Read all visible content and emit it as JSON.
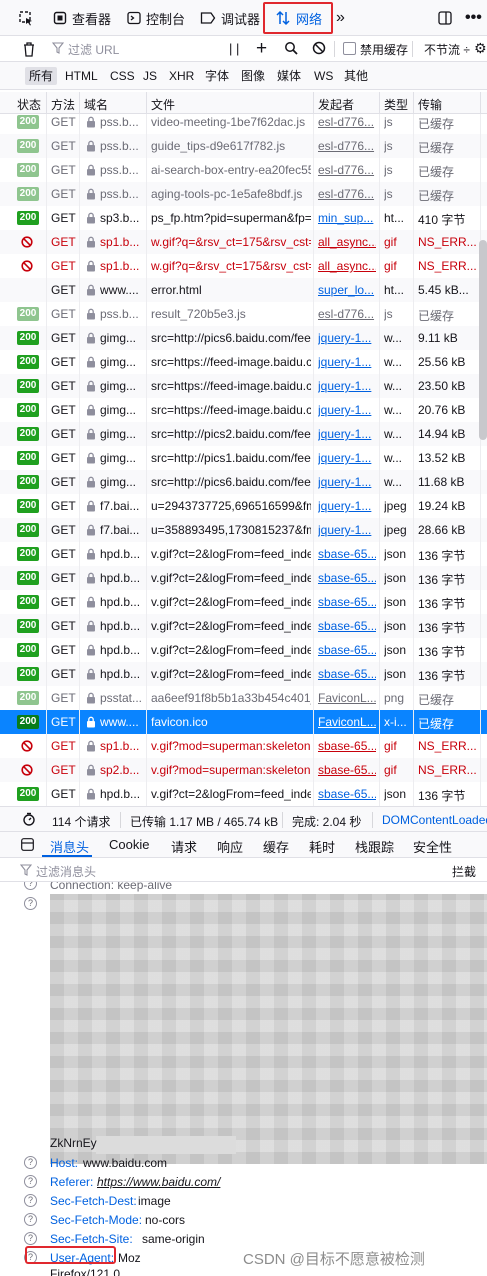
{
  "toolbar": {
    "tabs": [
      {
        "label": "查看器"
      },
      {
        "label": "控制台"
      },
      {
        "label": "调试器"
      },
      {
        "label": "网络"
      }
    ]
  },
  "filter": {
    "placeholder": "过滤 URL",
    "disable_cache": "禁用缓存",
    "throttle": "不节流 ÷"
  },
  "type_filters": [
    "所有",
    "HTML",
    "CSS",
    "JS",
    "XHR",
    "字体",
    "图像",
    "媒体",
    "WS",
    "其他"
  ],
  "columns": [
    "状态",
    "方法",
    "域名",
    "文件",
    "发起者",
    "类型",
    "传输"
  ],
  "requests": [
    {
      "status": "200",
      "state": "cached",
      "method": "GET",
      "domain": "pss.b...",
      "file": "video-meeting-1be7f62dac.js",
      "initiator": "esl-d776...",
      "type": "js",
      "transfer": "已缓存"
    },
    {
      "status": "200",
      "state": "cached",
      "method": "GET",
      "domain": "pss.b...",
      "file": "guide_tips-d9e617f782.js",
      "initiator": "esl-d776...",
      "type": "js",
      "transfer": "已缓存"
    },
    {
      "status": "200",
      "state": "cached",
      "method": "GET",
      "domain": "pss.b...",
      "file": "ai-search-box-entry-ea20fec55",
      "initiator": "esl-d776...",
      "type": "js",
      "transfer": "已缓存"
    },
    {
      "status": "200",
      "state": "cached",
      "method": "GET",
      "domain": "pss.b...",
      "file": "aging-tools-pc-1e5afe8bdf.js",
      "initiator": "esl-d776...",
      "type": "js",
      "transfer": "已缓存"
    },
    {
      "status": "200",
      "state": "ok",
      "method": "GET",
      "domain": "sp3.b...",
      "file": "ps_fp.htm?pid=superman&fp=",
      "initiator": "min_sup...",
      "type": "ht...",
      "transfer": "410 字节"
    },
    {
      "status": "blocked",
      "state": "err",
      "method": "GET",
      "domain": "sp1.b...",
      "file": "w.gif?q=&rsv_ct=175&rsv_cst=",
      "initiator": "all_async...",
      "type": "gif",
      "transfer": "NS_ERR..."
    },
    {
      "status": "blocked",
      "state": "err",
      "method": "GET",
      "domain": "sp1.b...",
      "file": "w.gif?q=&rsv_ct=175&rsv_cst=",
      "initiator": "all_async...",
      "type": "gif",
      "transfer": "NS_ERR..."
    },
    {
      "status": "",
      "state": "ok",
      "method": "GET",
      "domain": "www....",
      "file": "error.html",
      "initiator": "super_lo...",
      "type": "ht...",
      "transfer": "5.45 kB..."
    },
    {
      "status": "200",
      "state": "cached",
      "method": "GET",
      "domain": "pss.b...",
      "file": "result_720b5e3.js",
      "initiator": "esl-d776...",
      "type": "js",
      "transfer": "已缓存"
    },
    {
      "status": "200",
      "state": "ok",
      "method": "GET",
      "domain": "gimg...",
      "file": "src=http://pics6.baidu.com/fee",
      "initiator": "jquery-1...",
      "type": "w...",
      "transfer": "9.11 kB"
    },
    {
      "status": "200",
      "state": "ok",
      "method": "GET",
      "domain": "gimg...",
      "file": "src=https://feed-image.baidu.c",
      "initiator": "jquery-1...",
      "type": "w...",
      "transfer": "25.56 kB"
    },
    {
      "status": "200",
      "state": "ok",
      "method": "GET",
      "domain": "gimg...",
      "file": "src=https://feed-image.baidu.c",
      "initiator": "jquery-1...",
      "type": "w...",
      "transfer": "23.50 kB"
    },
    {
      "status": "200",
      "state": "ok",
      "method": "GET",
      "domain": "gimg...",
      "file": "src=https://feed-image.baidu.c",
      "initiator": "jquery-1...",
      "type": "w...",
      "transfer": "20.76 kB"
    },
    {
      "status": "200",
      "state": "ok",
      "method": "GET",
      "domain": "gimg...",
      "file": "src=http://pics2.baidu.com/fee",
      "initiator": "jquery-1...",
      "type": "w...",
      "transfer": "14.94 kB"
    },
    {
      "status": "200",
      "state": "ok",
      "method": "GET",
      "domain": "gimg...",
      "file": "src=http://pics1.baidu.com/fee",
      "initiator": "jquery-1...",
      "type": "w...",
      "transfer": "13.52 kB"
    },
    {
      "status": "200",
      "state": "ok",
      "method": "GET",
      "domain": "gimg...",
      "file": "src=http://pics6.baidu.com/fee",
      "initiator": "jquery-1...",
      "type": "w...",
      "transfer": "11.68 kB"
    },
    {
      "status": "200",
      "state": "ok",
      "method": "GET",
      "domain": "f7.bai...",
      "file": "u=2943737725,696516599&fm",
      "initiator": "jquery-1...",
      "type": "jpeg",
      "transfer": "19.24 kB"
    },
    {
      "status": "200",
      "state": "ok",
      "method": "GET",
      "domain": "f7.bai...",
      "file": "u=358893495,1730815237&fm",
      "initiator": "jquery-1...",
      "type": "jpeg",
      "transfer": "28.66 kB"
    },
    {
      "status": "200",
      "state": "ok",
      "method": "GET",
      "domain": "hpd.b...",
      "file": "v.gif?ct=2&logFrom=feed_inde",
      "initiator": "sbase-65...",
      "type": "json",
      "transfer": "136 字节"
    },
    {
      "status": "200",
      "state": "ok",
      "method": "GET",
      "domain": "hpd.b...",
      "file": "v.gif?ct=2&logFrom=feed_inde",
      "initiator": "sbase-65...",
      "type": "json",
      "transfer": "136 字节"
    },
    {
      "status": "200",
      "state": "ok",
      "method": "GET",
      "domain": "hpd.b...",
      "file": "v.gif?ct=2&logFrom=feed_inde",
      "initiator": "sbase-65...",
      "type": "json",
      "transfer": "136 字节"
    },
    {
      "status": "200",
      "state": "ok",
      "method": "GET",
      "domain": "hpd.b...",
      "file": "v.gif?ct=2&logFrom=feed_inde",
      "initiator": "sbase-65...",
      "type": "json",
      "transfer": "136 字节"
    },
    {
      "status": "200",
      "state": "ok",
      "method": "GET",
      "domain": "hpd.b...",
      "file": "v.gif?ct=2&logFrom=feed_inde",
      "initiator": "sbase-65...",
      "type": "json",
      "transfer": "136 字节"
    },
    {
      "status": "200",
      "state": "ok",
      "method": "GET",
      "domain": "hpd.b...",
      "file": "v.gif?ct=2&logFrom=feed_inde",
      "initiator": "sbase-65...",
      "type": "json",
      "transfer": "136 字节"
    },
    {
      "status": "200",
      "state": "cached",
      "method": "GET",
      "domain": "psstat...",
      "file": "aa6eef91f8b5b1a33b454c401_",
      "initiator": "FaviconL...",
      "type": "png",
      "transfer": "已缓存"
    },
    {
      "status": "200",
      "state": "sel",
      "method": "GET",
      "domain": "www....",
      "file": "favicon.ico",
      "initiator": "FaviconL...",
      "type": "x-i...",
      "transfer": "已缓存"
    },
    {
      "status": "blocked",
      "state": "err",
      "method": "GET",
      "domain": "sp1.b...",
      "file": "v.gif?mod=superman:skeleton",
      "initiator": "sbase-65...",
      "type": "gif",
      "transfer": "NS_ERR..."
    },
    {
      "status": "blocked",
      "state": "err",
      "method": "GET",
      "domain": "sp2.b...",
      "file": "v.gif?mod=superman:skeleton",
      "initiator": "sbase-65...",
      "type": "gif",
      "transfer": "NS_ERR..."
    },
    {
      "status": "200",
      "state": "ok",
      "method": "GET",
      "domain": "hpd.b...",
      "file": "v.gif?ct=2&logFrom=feed_inde",
      "initiator": "sbase-65...",
      "type": "json",
      "transfer": "136 字节"
    }
  ],
  "summary": {
    "requests": "114 个请求",
    "transferred": "已传输 1.17 MB / 465.74 kB",
    "finish": "完成: 2.04 秒",
    "dcl": "DOMContentLoaded"
  },
  "detail_tabs": [
    "消息头",
    "Cookie",
    "请求",
    "响应",
    "缓存",
    "耗时",
    "栈跟踪",
    "安全性"
  ],
  "detail_filter": {
    "placeholder": "过滤消息头",
    "raw": "拦截"
  },
  "headers": {
    "connection": "Connection: keep-alive",
    "partial": "ZkNrnEy",
    "list": [
      {
        "name": "Host:",
        "value": "www.baidu.com"
      },
      {
        "name": "Referer:",
        "value": "https://www.baidu.com/"
      },
      {
        "name": "Sec-Fetch-Dest:",
        "value": "image"
      },
      {
        "name": "Sec-Fetch-Mode:",
        "value": "no-cors"
      },
      {
        "name": "Sec-Fetch-Site:",
        "value": "same-origin"
      },
      {
        "name": "User-Agent:",
        "value": "Moz"
      }
    ],
    "ua_cont": "Firefox/121.0"
  },
  "watermark": "CSDN @目标不愿意被检测",
  "colors": {
    "accent": "#0061e0",
    "error": "#c7000b",
    "ok": "#20a020",
    "highlight": "#e0282e",
    "selected": "#0a84ff"
  }
}
